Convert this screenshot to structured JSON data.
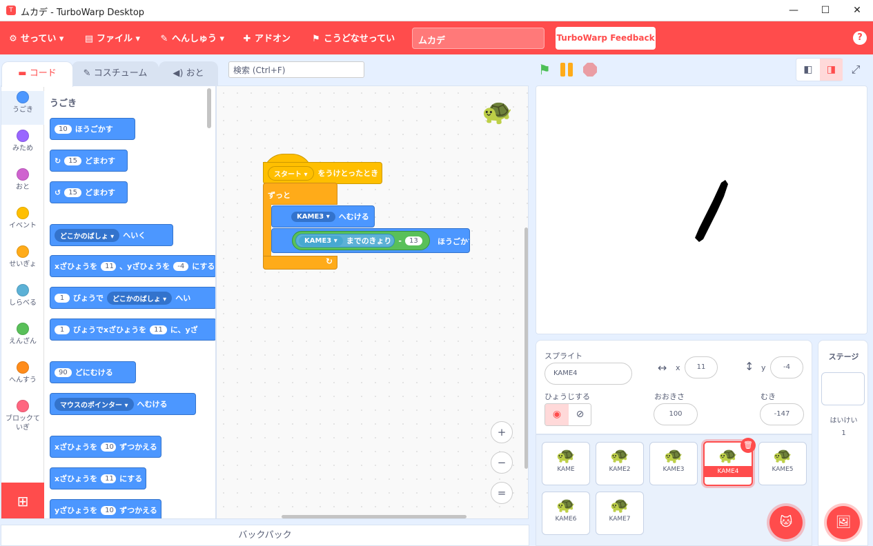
{
  "window": {
    "title": "ムカデ - TurboWarp Desktop",
    "app_icon": "turbowarp-icon",
    "minimize": "—",
    "maximize": "☐",
    "close": "✕"
  },
  "menu": {
    "settings": "せってい",
    "file": "ファイル",
    "edit": "へんしゅう",
    "addons": "アドオン",
    "how_made": "こうどなせってい",
    "project_title": "ムカデ",
    "feedback": "TurboWarp Feedback",
    "help": "?"
  },
  "tabs": {
    "code": "コード",
    "costumes": "コスチューム",
    "sounds": "おと"
  },
  "search": {
    "placeholder": "検索 (Ctrl+F)"
  },
  "categories": [
    {
      "label": "うごき",
      "color": "#4c97ff"
    },
    {
      "label": "みため",
      "color": "#9966ff"
    },
    {
      "label": "おと",
      "color": "#cf63cf"
    },
    {
      "label": "イベント",
      "color": "#ffbf00"
    },
    {
      "label": "せいぎょ",
      "color": "#ffab19"
    },
    {
      "label": "しらべる",
      "color": "#5cb1d6"
    },
    {
      "label": "えんざん",
      "color": "#59c059"
    },
    {
      "label": "へんすう",
      "color": "#ff8c1a"
    },
    {
      "label": "ブロックて\nいぎ",
      "color": "#ff6680"
    }
  ],
  "palette": {
    "title": "うごき",
    "move_val": "10",
    "move_txt": "ほうごかす",
    "turn_right_val": "15",
    "turn_txt": "どまわす",
    "turn_left_val": "15",
    "goto_menu": "どこかのばしょ",
    "goto_txt": "へいく",
    "gotoxy_pre": "xざひょうを",
    "gotoxy_x": "11",
    "gotoxy_mid": "、yざひょうを",
    "gotoxy_y": "-4",
    "gotoxy_post": "にする",
    "glide_val": "1",
    "glide_txt": "びょうで",
    "glide_menu": "どこかのばしょ",
    "glide_post": "へい",
    "glidexy_val": "1",
    "glidexy_txt": "びょうでxざひょうを",
    "glidexy_x": "11",
    "glidexy_post": "に、yざ",
    "point_val": "90",
    "point_txt": "どにむける",
    "pointto_menu": "マウスのポインター",
    "pointto_txt": "へむける",
    "changex_pre": "xざひょうを",
    "changex_val": "10",
    "changex_post": "ずつかえる",
    "setx_pre": "xざひょうを",
    "setx_val": "11",
    "setx_post": "にする",
    "changey_pre": "yざひょうを",
    "changey_val": "10",
    "changey_post": "ずつかえる"
  },
  "script": {
    "hat_menu": "スタート",
    "hat_txt": "をうけとったとき",
    "forever": "ずっと",
    "pointto_menu": "KAME3",
    "pointto_txt": "へむける",
    "dist_menu": "KAME3",
    "dist_txt": "までのきょり",
    "minus": "-",
    "minus_val": "13",
    "move_txt": "ほうごかす"
  },
  "zoom": {
    "in": "+",
    "out": "−",
    "reset": "="
  },
  "backpack": "バックパック",
  "sprite_info": {
    "sprite_label": "スプライト",
    "sprite_name": "KAME4",
    "x_label": "x",
    "x": "11",
    "y_label": "y",
    "y": "-4",
    "show_label": "ひょうじする",
    "size_label": "おおきさ",
    "size": "100",
    "direction_label": "むき",
    "direction": "-147"
  },
  "sprites": [
    "KAME",
    "KAME2",
    "KAME3",
    "KAME4",
    "KAME5",
    "KAME6",
    "KAME7"
  ],
  "stage_panel": {
    "title": "ステージ",
    "backdrops_label": "はいけい",
    "backdrops_count": "1"
  }
}
